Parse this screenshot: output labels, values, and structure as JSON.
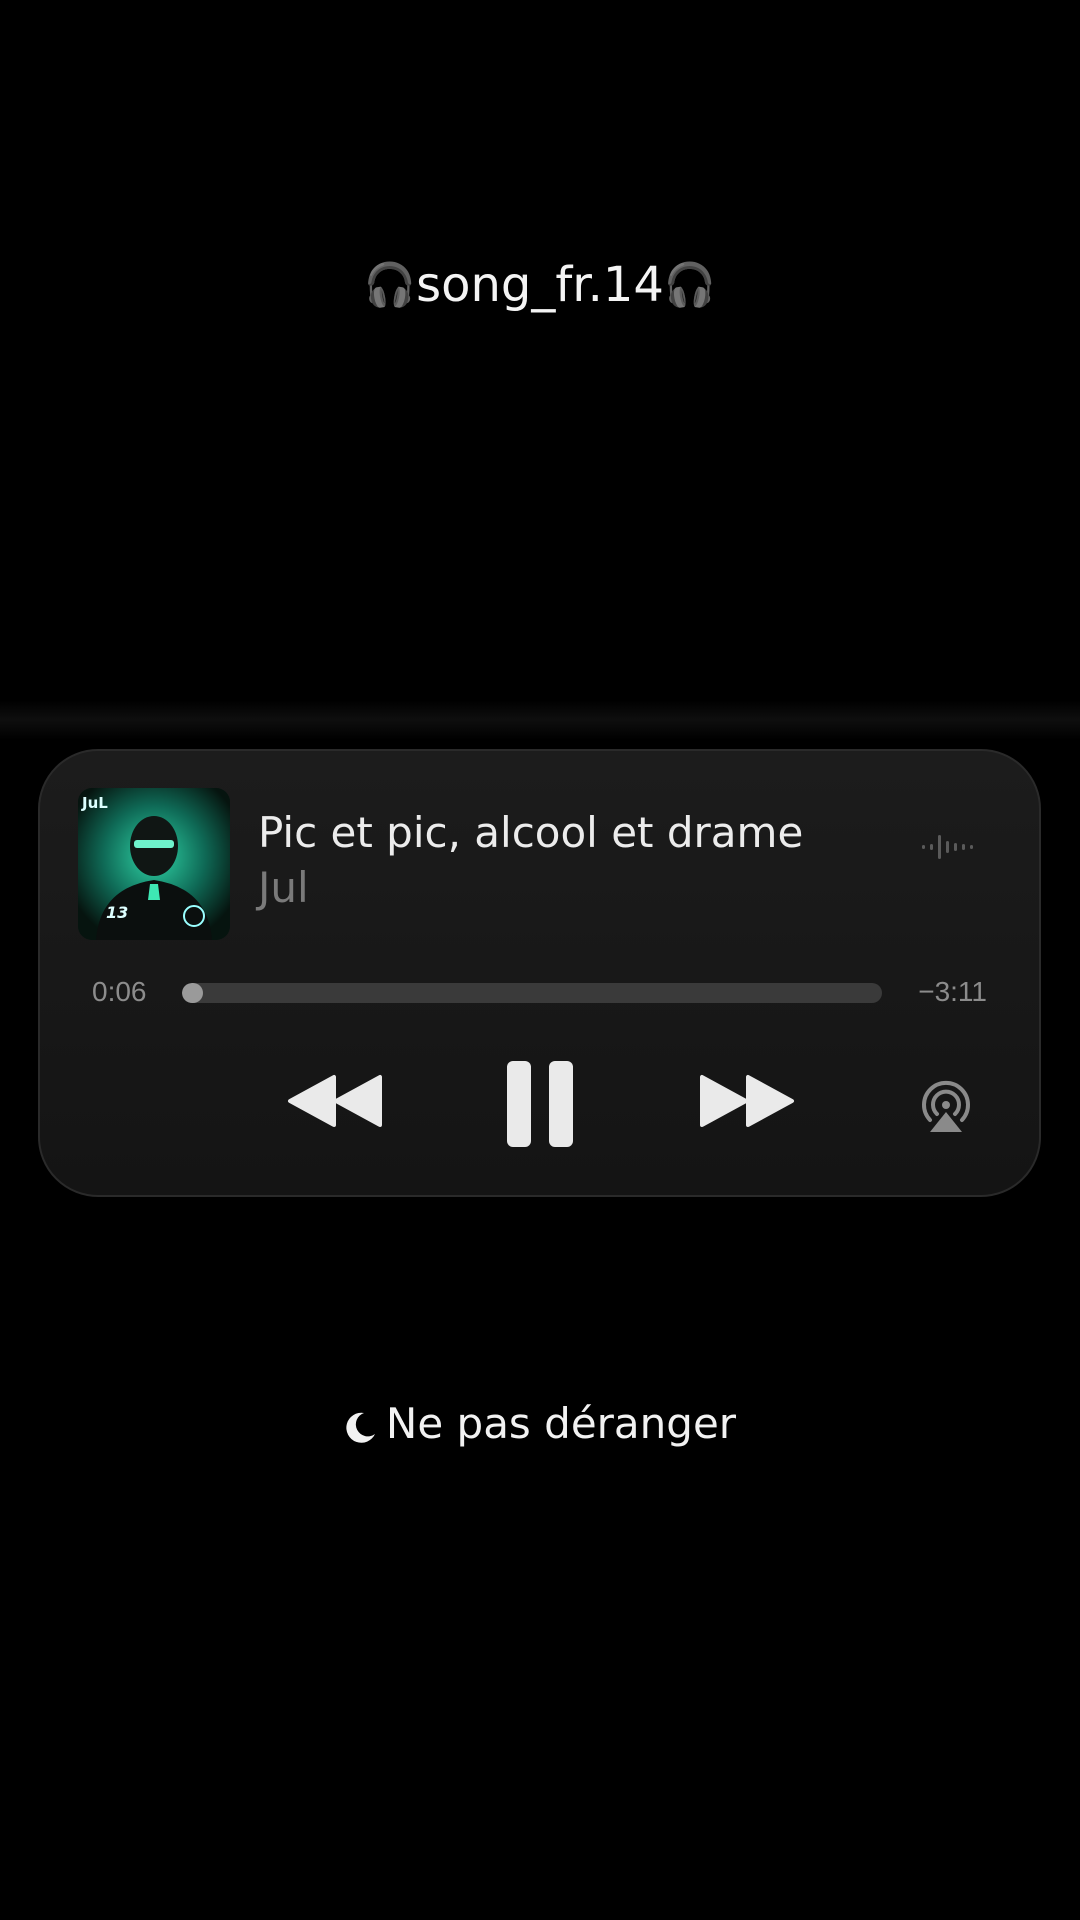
{
  "overlay": {
    "handle": "song_fr.14",
    "handle_icon": "headphones-icon"
  },
  "now_playing": {
    "title": "Pic et pic, alcool et drame",
    "artist": "Jul",
    "cover_text": {
      "artist_logo": "JuL",
      "number": "13"
    },
    "elapsed": "0:06",
    "remaining": "−3:11",
    "progress_fraction": 0.03,
    "controls": [
      "rewind-icon",
      "pause-icon",
      "fast-forward-icon",
      "airplay-icon"
    ],
    "waveform_icon": "waveform-icon"
  },
  "focus": {
    "icon": "moon-icon",
    "label": "Ne pas déranger"
  },
  "colors": {
    "background": "#000000",
    "card": "#1a1a1a",
    "cover_accent": "#2fd4a6"
  }
}
